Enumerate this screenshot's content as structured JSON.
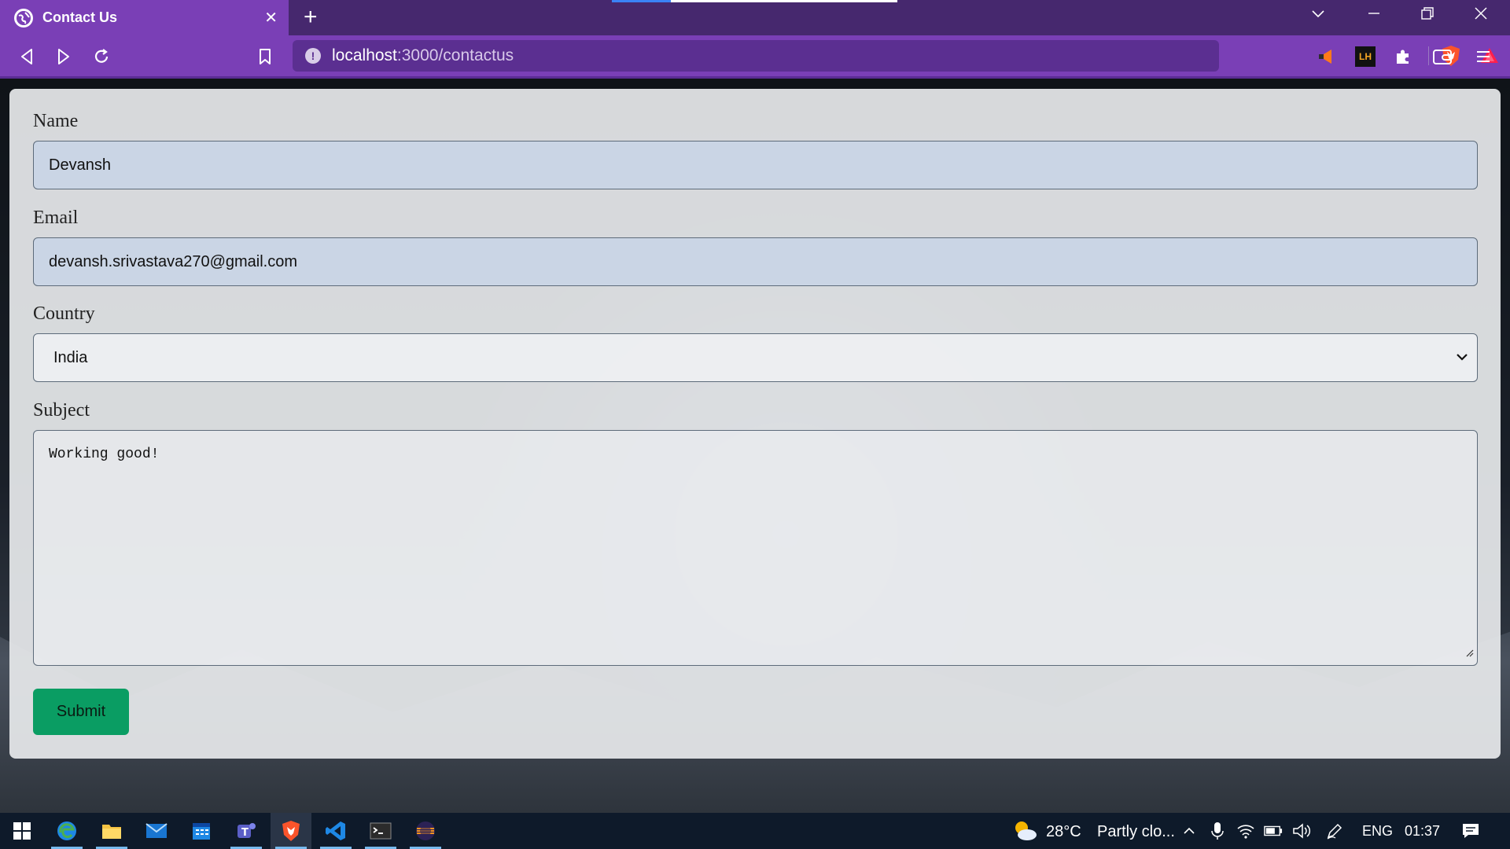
{
  "browser": {
    "tab_title": "Contact Us",
    "url_host": "localhost",
    "url_path": ":3000/contactus",
    "ext_lh_label": "LH"
  },
  "form": {
    "name_label": "Name",
    "name_value": "Devansh",
    "email_label": "Email",
    "email_value": "devansh.srivastava270@gmail.com",
    "country_label": "Country",
    "country_value": "India",
    "subject_label": "Subject",
    "subject_value": "Working good!",
    "submit_label": "Submit"
  },
  "taskbar": {
    "weather_temp": "28°C",
    "weather_text": "Partly clo...",
    "language": "ENG",
    "time": "01:37"
  },
  "colors": {
    "chrome_purple": "#7a3fb6",
    "submit_green": "#0a9d63"
  }
}
